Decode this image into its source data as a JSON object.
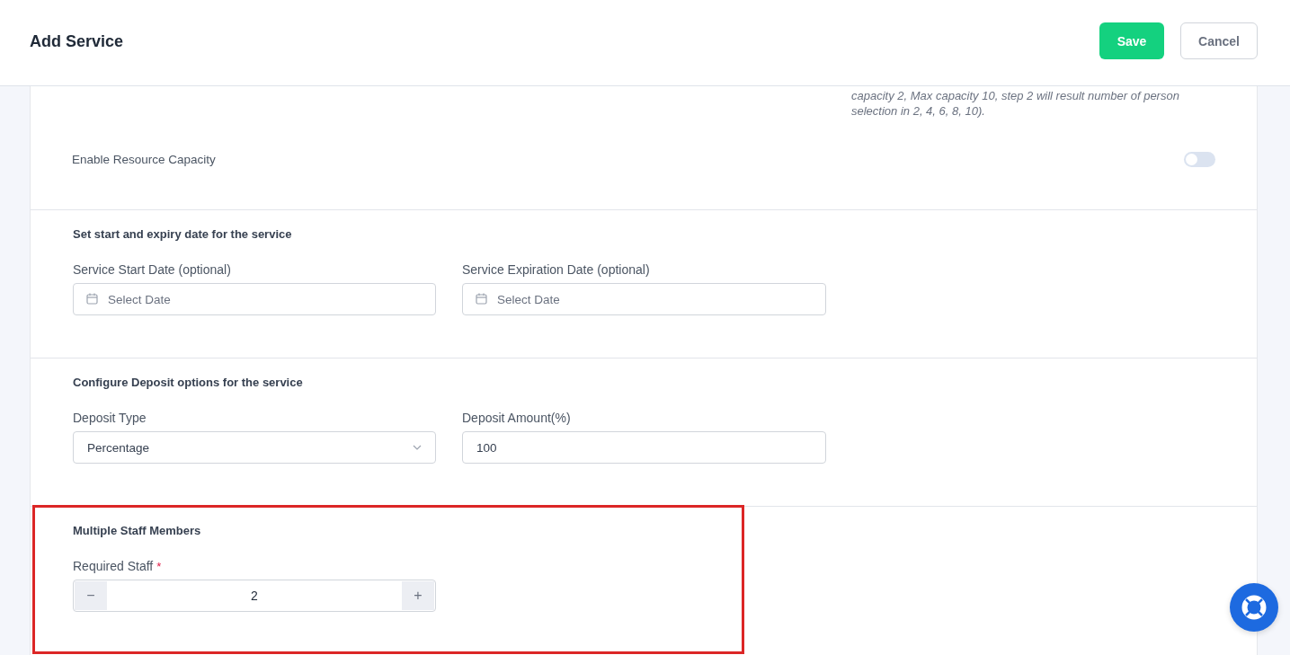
{
  "header": {
    "title": "Add Service",
    "buttons": [
      {
        "label": "Save",
        "kind": "primary"
      },
      {
        "label": "Cancel",
        "kind": "secondary"
      }
    ]
  },
  "capacity_section": {
    "help_lines": [
      "capacity 2, Max capacity 10, step 2 will result number of person",
      "selection in 2, 4, 6, 8, 10)."
    ],
    "toggle": {
      "label": "Enable Resource Capacity",
      "on": false
    }
  },
  "date_section": {
    "title": "Set start and expiry date for the service",
    "highlighted": false,
    "fields": [
      {
        "label": "Service Start Date (optional)",
        "placeholder": "Select Date",
        "kind": "date"
      },
      {
        "label": "Service Expiration Date (optional)",
        "placeholder": "Select Date",
        "kind": "date"
      }
    ]
  },
  "deposit_section": {
    "title": "Configure Deposit options for the service",
    "highlighted": false,
    "fields": [
      {
        "label": "Deposit Type",
        "value": "Percentage",
        "kind": "select"
      },
      {
        "label": "Deposit Amount(%)",
        "value": "100",
        "kind": "text"
      }
    ]
  },
  "staff_section": {
    "title": "Multiple Staff Members",
    "highlighted": true,
    "fields": [
      {
        "label": "Required Staff",
        "required_mark": "*",
        "value": "2",
        "kind": "stepper",
        "decrement": "−",
        "increment": "+"
      }
    ]
  }
}
